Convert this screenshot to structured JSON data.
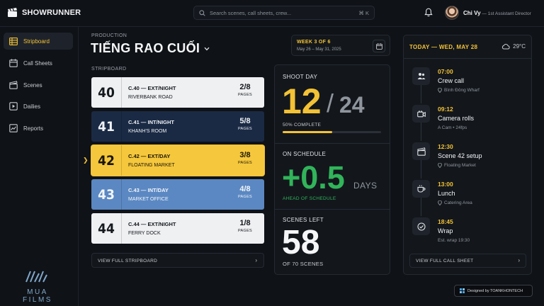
{
  "app": {
    "name": "SHOWRUNNER"
  },
  "search": {
    "placeholder": "Search scenes, call sheets, crew...",
    "shortcut": "⌘ K"
  },
  "user": {
    "name": "Chi Vy",
    "separator": " — ",
    "role": "1st Assistant Director"
  },
  "sidebar": {
    "items": [
      {
        "label": "Stripboard",
        "icon": "stripboard-icon",
        "active": true
      },
      {
        "label": "Call Sheets",
        "icon": "calendar-icon",
        "active": false
      },
      {
        "label": "Scenes",
        "icon": "clapperboard-icon",
        "active": false
      },
      {
        "label": "Dailies",
        "icon": "play-icon",
        "active": false
      },
      {
        "label": "Reports",
        "icon": "chart-icon",
        "active": false
      }
    ],
    "studio_logo": "MUA FILMS"
  },
  "production": {
    "label": "PRODUCTION",
    "title": "TIẾNG RAO CUỐI"
  },
  "week": {
    "title": "WEEK 3 OF 6",
    "dates": "May 26 – May 31, 2025"
  },
  "stripboard": {
    "label": "STRIPBOARD",
    "view_all": "VIEW FULL STRIPBOARD",
    "strips": [
      {
        "num": "40",
        "heading": "C.40 — EXT/NIGHT",
        "location": "RIVERBANK ROAD",
        "pages": "2/8",
        "pages_label": "PAGES",
        "bg": "#eef0f2",
        "fg": "#15181c"
      },
      {
        "num": "41",
        "heading": "C.41 — INT/NIGHT",
        "location": "KHANH'S ROOM",
        "pages": "5/8",
        "pages_label": "PAGES",
        "bg": "#1b2a44",
        "fg": "#eef1f6"
      },
      {
        "num": "42",
        "heading": "C.42 — EXT/DAY",
        "location": "FLOATING MARKET",
        "pages": "3/8",
        "pages_label": "PAGES",
        "bg": "#f5c73c",
        "fg": "#1a1608"
      },
      {
        "num": "43",
        "heading": "C.43 — INT/DAY",
        "location": "MARKET OFFICE",
        "pages": "4/8",
        "pages_label": "PAGES",
        "bg": "#5b88c2",
        "fg": "#f2f6fb"
      },
      {
        "num": "44",
        "heading": "C.44 — EXT/NIGHT",
        "location": "FERRY DOCK",
        "pages": "1/8",
        "pages_label": "PAGES",
        "bg": "#eef0f2",
        "fg": "#15181c"
      }
    ],
    "current_index": 2
  },
  "stats": {
    "shoot_day": {
      "label": "SHOOT DAY",
      "current": "12",
      "separator": "/",
      "total": "24",
      "progress_text": "50% COMPLETE",
      "progress": 0.5
    },
    "schedule": {
      "label": "ON SCHEDULE",
      "value": "+0.5",
      "unit": "DAYS",
      "sub": "AHEAD OF SCHEDULE"
    },
    "scenes": {
      "label": "SCENES LEFT",
      "value": "58",
      "sub": "OF 70 SCENES"
    }
  },
  "callsheet": {
    "date": "TODAY — WED, MAY 28",
    "weather": "29°C",
    "view_all": "VIEW FULL CALL SHEET",
    "events": [
      {
        "time": "07:00",
        "title": "Crew call",
        "sub": "Bình Đông Wharf",
        "icon": "crew-icon",
        "pin": true
      },
      {
        "time": "09:12",
        "title": "Camera rolls",
        "sub": "A Cam • 24fps",
        "icon": "camera-icon",
        "pin": false
      },
      {
        "time": "12:30",
        "title": "Scene 42 setup",
        "sub": "Floating Market",
        "icon": "clapperboard-icon",
        "pin": true
      },
      {
        "time": "13:00",
        "title": "Lunch",
        "sub": "Catering Area",
        "icon": "coffee-icon",
        "pin": true
      },
      {
        "time": "18:45",
        "title": "Wrap",
        "sub": "Est. wrap 19:30",
        "icon": "check-circle-icon",
        "pin": false
      }
    ]
  },
  "credit": {
    "text": "Designed by TOANKHONTECH"
  },
  "colors": {
    "accent": "#f3c235",
    "positive": "#31b45a",
    "background": "#0f1217"
  }
}
